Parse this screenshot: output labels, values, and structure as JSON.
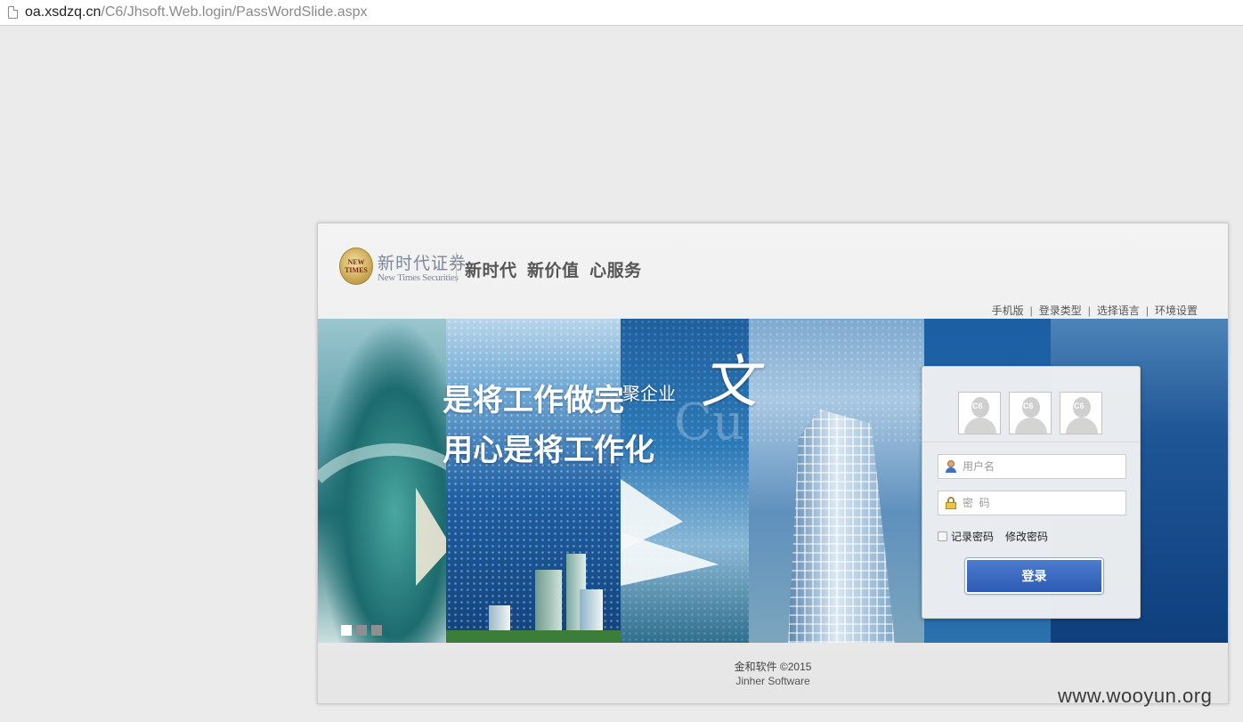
{
  "browser": {
    "url_host": "oa.xsdzq.cn",
    "url_path": "/C6/Jhsoft.Web.login/PassWordSlide.aspx",
    "page_icon": "page-icon"
  },
  "header": {
    "logo_emblem_text": "NEW TIMES",
    "logo_cn": "新时代证券",
    "logo_en": "New Times Securities",
    "slogan": "新时代  新价值  心服务",
    "links": [
      {
        "label": "手机版"
      },
      {
        "label": "登录类型"
      },
      {
        "label": "选择语言"
      },
      {
        "label": "环境设置"
      }
    ],
    "separator": "|"
  },
  "banner": {
    "text_line1": "是将工作做完",
    "text_line2": "用心是将工作化",
    "text_line3": "聚企业",
    "script_text": "文",
    "script_watermark": "Cu",
    "slides": 3,
    "active_slide": 1
  },
  "login": {
    "avatar_labels": [
      "C6",
      "C6",
      "C6"
    ],
    "username_placeholder": "用户名",
    "password_placeholder": "密  码",
    "remember_label": "记录密码",
    "change_password_label": "修改密码",
    "login_button": "登录"
  },
  "footer": {
    "copyright": "金和软件 ©2015",
    "company": "Jinher Software"
  },
  "watermark": "www.wooyun.org",
  "colors": {
    "page_bg": "#ebebeb",
    "login_button": "#2d5bb2",
    "banner_blue": "#11427c",
    "text_dark": "#555555"
  }
}
